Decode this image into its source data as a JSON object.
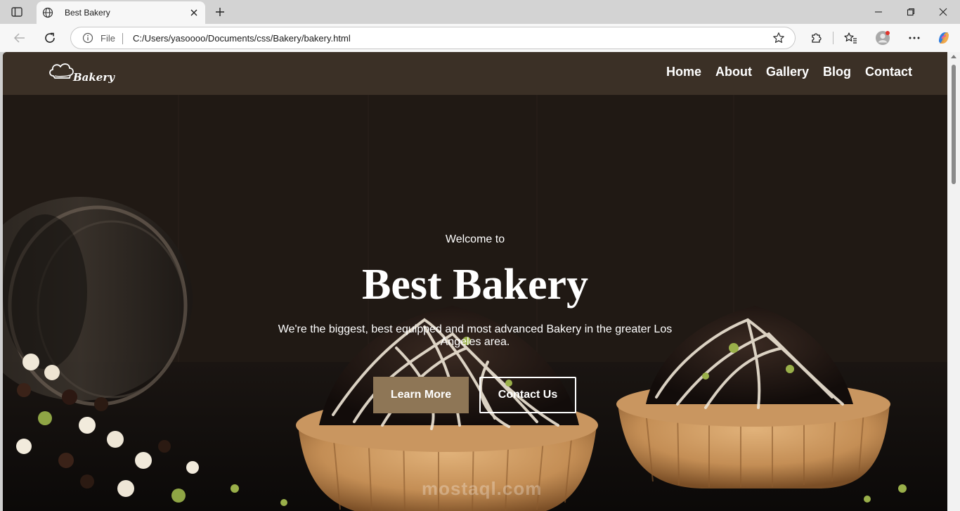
{
  "browser": {
    "tab_title": "Best Bakery",
    "address_scheme_label": "File",
    "url": "C:/Users/yasoooo/Documents/css/Bakery/bakery.html"
  },
  "site": {
    "logo_text": "Bakery",
    "nav": [
      "Home",
      "About",
      "Gallery",
      "Blog",
      "Contact"
    ]
  },
  "hero": {
    "welcome": "Welcome to",
    "title": "Best Bakery",
    "description": "We're the biggest, best equipped and most advanced Bakery in the greater Los Angeles area.",
    "primary_button": "Learn More",
    "secondary_button": "Contact Us"
  },
  "watermark": "mostaql.com",
  "colors": {
    "header_bg": "#3b3026",
    "button_primary": "#8e7656",
    "text": "#ffffff"
  }
}
